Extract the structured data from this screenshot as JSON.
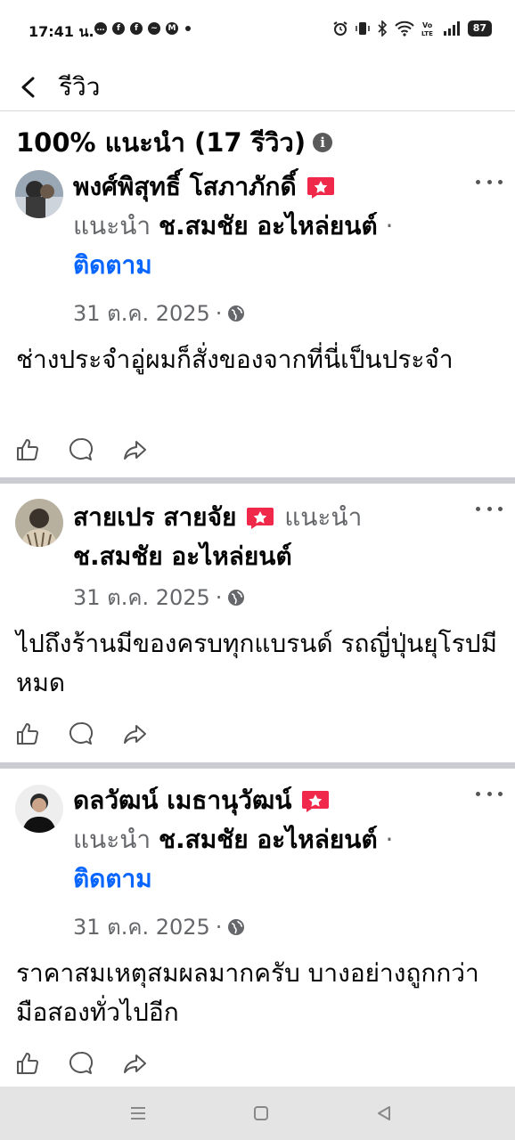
{
  "status_bar": {
    "time": "17:41 น.",
    "battery": "87",
    "notif_icons": [
      "chat-icon",
      "facebook-icon",
      "facebook-icon",
      "messenger-icon",
      "mail-icon"
    ],
    "right_icons": [
      "alarm-icon",
      "vibrate-icon",
      "bluetooth-icon",
      "wifi-icon",
      "volte-icon",
      "signal-icon"
    ]
  },
  "header": {
    "title": "รีวิว"
  },
  "summary": {
    "text": "100% แนะนำ (17 รีวิว)"
  },
  "colors": {
    "link": "#0866ff",
    "muted": "#65676b",
    "badge": "#f02849",
    "divider": "#c9ccd1"
  },
  "reviews": [
    {
      "name": "พงศ์พิสุทธิ์  โสภาภักดิ์",
      "recommends": "แนะนำ",
      "page": "ช.สมชัย อะไหล่ยนต์",
      "sep": "·",
      "follow": "ติดตาม",
      "date": "31 ต.ค. 2025",
      "dot": "·",
      "text": "ช่างประจำอู่ผมก็สั่งของจากที่นี่เป็นประจำ"
    },
    {
      "name": "สายเปร สายจัย",
      "recommends": "แนะนำ",
      "page": "ช.สมชัย อะไหล่ยนต์",
      "date": "31 ต.ค. 2025",
      "dot": "·",
      "text": "ไปถึงร้านมีของครบทุกแบรนด์ รถญี่ปุ่นยุโรปมีหมด"
    },
    {
      "name": "ดลวัฒน์ เมธานุวัฒน์",
      "recommends": "แนะนำ",
      "page": "ช.สมชัย อะไหล่ยนต์",
      "sep": "·",
      "follow": "ติดตาม",
      "date": "31 ต.ค. 2025",
      "dot": "·",
      "text": "ราคาสมเหตุสมผลมากครับ บางอย่างถูกกว่ามือสองทั่วไปอีก"
    }
  ]
}
